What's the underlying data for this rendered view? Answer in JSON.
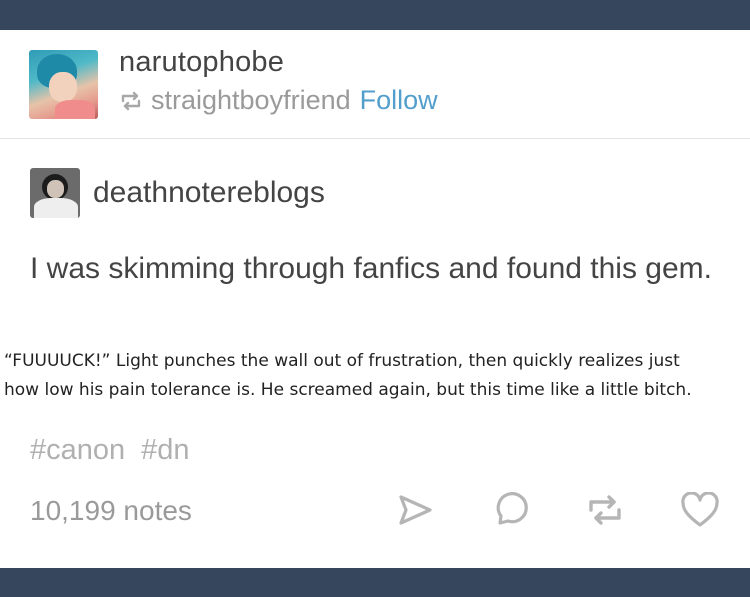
{
  "reblogger": {
    "username": "narutophobe",
    "reblogged_from": "straightboyfriend",
    "follow_label": "Follow"
  },
  "original_post": {
    "username": "deathnotereblogs",
    "text": "I was skimming through fanfics and found this gem.",
    "quote_lines": [
      "“FUUUUCK!” Light punches the wall out of frustration, then quickly realizes just",
      "how low his pain tolerance is. He screamed again, but this time like a little bitch."
    ]
  },
  "tags": [
    "#canon",
    "#dn"
  ],
  "footer": {
    "notes": "10,199 notes",
    "actions": [
      "share-icon",
      "reply-icon",
      "reblog-icon",
      "like-icon"
    ]
  },
  "colors": {
    "top_bar": "#36465d",
    "follow_link": "#529ecc",
    "muted": "#9a9a9a",
    "text": "#444444"
  }
}
